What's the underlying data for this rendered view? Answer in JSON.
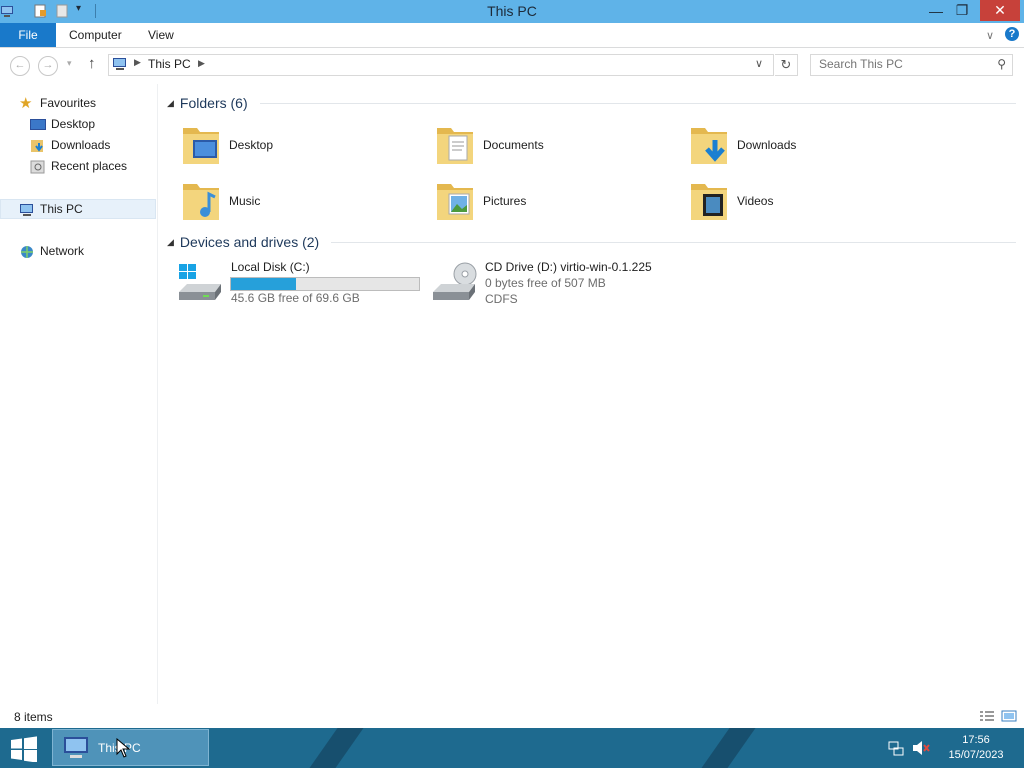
{
  "window": {
    "title": "This PC",
    "controls": {
      "minimize": "—",
      "restore": "❐",
      "close": "✕"
    }
  },
  "ribbon": {
    "tabs": [
      "File",
      "Computer",
      "View"
    ],
    "help": "?"
  },
  "address": {
    "crumbs": [
      "This PC"
    ],
    "search_placeholder": "Search This PC"
  },
  "nav_pane": {
    "favourites_label": "Favourites",
    "favourites": [
      "Desktop",
      "Downloads",
      "Recent places"
    ],
    "this_pc": "This PC",
    "network": "Network"
  },
  "content": {
    "folders_header": "Folders (6)",
    "folders": [
      "Desktop",
      "Documents",
      "Downloads",
      "Music",
      "Pictures",
      "Videos"
    ],
    "devices_header": "Devices and drives (2)",
    "drives": [
      {
        "name": "Local Disk (C:)",
        "free": "45.6 GB free of 69.6 GB",
        "used_fraction": 0.345
      },
      {
        "name": "CD Drive (D:) virtio-win-0.1.225",
        "free": "0 bytes free of 507 MB",
        "fs": "CDFS"
      }
    ]
  },
  "status": {
    "item_count": "8 items"
  },
  "taskbar": {
    "task_label": "This PC",
    "time": "17:56",
    "date": "15/07/2023"
  },
  "colors": {
    "titlebar": "#5fb3e8",
    "file_tab": "#1979ca",
    "close": "#c7413a",
    "taskbar": "#1e6a8f",
    "drive_bar_fill": "#26a0da"
  }
}
